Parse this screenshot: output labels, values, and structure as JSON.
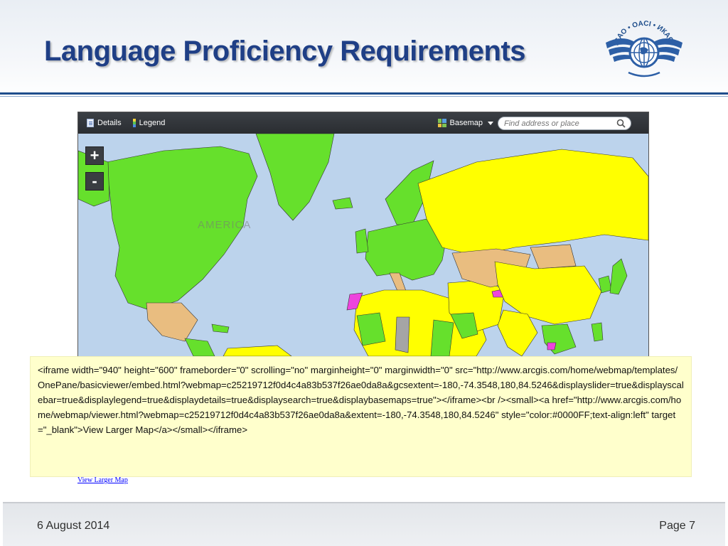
{
  "slide": {
    "title": "Language Proficiency Requirements",
    "logo_text": "ICAO • OACI • ИКАО",
    "footer_date": "6 August 2014",
    "footer_page": "Page 7"
  },
  "map": {
    "toolbar": {
      "details_label": "Details",
      "legend_label": "Legend",
      "basemap_label": "Basemap",
      "search_placeholder": "Find address or place"
    },
    "zoom_in_label": "+",
    "zoom_out_label": "-",
    "continent_label": "AMERICA",
    "colors": {
      "ocean": "#bcd3ec",
      "green": "#66e02c",
      "yellow": "#ffff00",
      "tan": "#e9bd80",
      "gray": "#a5a5a5",
      "magenta": "#ee44dd"
    }
  },
  "embed_note": {
    "code": "<iframe width=\"940\" height=\"600\" frameborder=\"0\" scrolling=\"no\" marginheight=\"0\" marginwidth=\"0\" src=\"http://www.arcgis.com/home/webmap/templates/OnePane/basicviewer/embed.html?webmap=c25219712f0d4c4a83b537f26ae0da8a&gcsextent=-180,-74.3548,180,84.5246&displayslider=true&displayscalebar=true&displaylegend=true&displaydetails=true&displaysearch=true&displaybasemaps=true\"></iframe><br /><small><a href=\"http://www.arcgis.com/home/webmap/viewer.html?webmap=c25219712f0d4c4a83b537f26ae0da8a&extent=-180,-74.3548,180,84.5246\" style=\"color:#0000FF;text-align:left\" target=\"_blank\">View Larger Map</a></small></iframe>"
  },
  "view_larger_link": "View Larger Map"
}
